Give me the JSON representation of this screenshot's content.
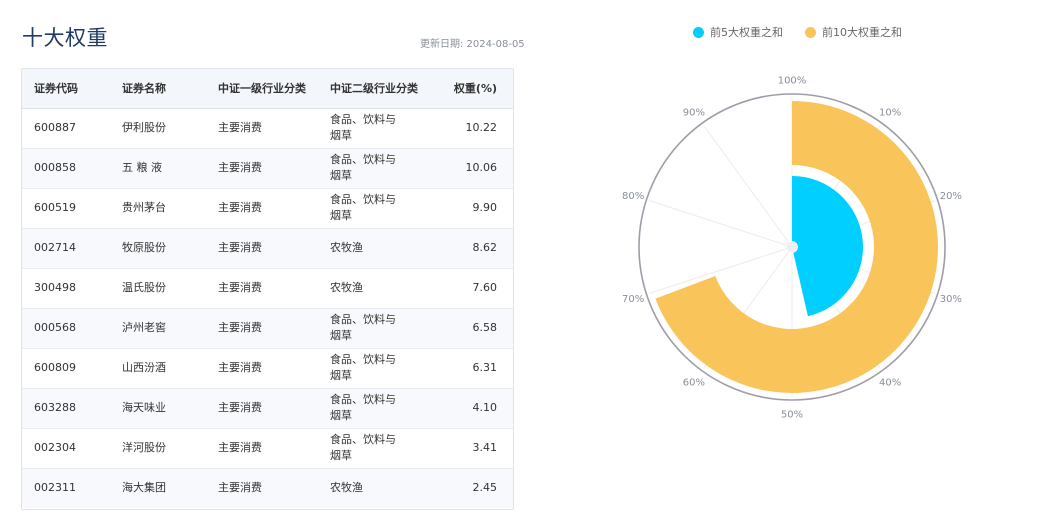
{
  "header": {
    "title": "十大权重",
    "update_date": "更新日期: 2024-08-05"
  },
  "table": {
    "columns": [
      "证券代码",
      "证券名称",
      "中证一级行业分类",
      "中证二级行业分类",
      "权重(%)"
    ],
    "rows": [
      {
        "code": "600887",
        "name": "伊利股份",
        "level1": "主要消费",
        "level2": "食品、饮料与烟草",
        "weight": "10.22"
      },
      {
        "code": "000858",
        "name": "五 粮 液",
        "level1": "主要消费",
        "level2": "食品、饮料与烟草",
        "weight": "10.06"
      },
      {
        "code": "600519",
        "name": "贵州茅台",
        "level1": "主要消费",
        "level2": "食品、饮料与烟草",
        "weight": "9.90"
      },
      {
        "code": "002714",
        "name": "牧原股份",
        "level1": "主要消费",
        "level2": "农牧渔",
        "weight": "8.62"
      },
      {
        "code": "300498",
        "name": "温氏股份",
        "level1": "主要消费",
        "level2": "农牧渔",
        "weight": "7.60"
      },
      {
        "code": "000568",
        "name": "泸州老窖",
        "level1": "主要消费",
        "level2": "食品、饮料与烟草",
        "weight": "6.58"
      },
      {
        "code": "600809",
        "name": "山西汾酒",
        "level1": "主要消费",
        "level2": "食品、饮料与烟草",
        "weight": "6.31"
      },
      {
        "code": "603288",
        "name": "海天味业",
        "level1": "主要消费",
        "level2": "食品、饮料与烟草",
        "weight": "4.10"
      },
      {
        "code": "002304",
        "name": "洋河股份",
        "level1": "主要消费",
        "level2": "食品、饮料与烟草",
        "weight": "3.41"
      },
      {
        "code": "002311",
        "name": "海大集团",
        "level1": "主要消费",
        "level2": "农牧渔",
        "weight": "2.45"
      }
    ]
  },
  "chart_data": {
    "type": "polar-bar",
    "series": [
      {
        "name": "前5大权重之和",
        "value": 46.4,
        "color": "#00cfff"
      },
      {
        "name": "前10大权重之和",
        "value": 69.25,
        "color": "#f9c55a"
      }
    ],
    "angle_axis": {
      "min": 0,
      "max": 100,
      "tick_labels": [
        "100%",
        "10%",
        "20%",
        "30%",
        "40%",
        "50%",
        "60%",
        "70%",
        "80%",
        "90%"
      ]
    },
    "legend_position": "top"
  }
}
